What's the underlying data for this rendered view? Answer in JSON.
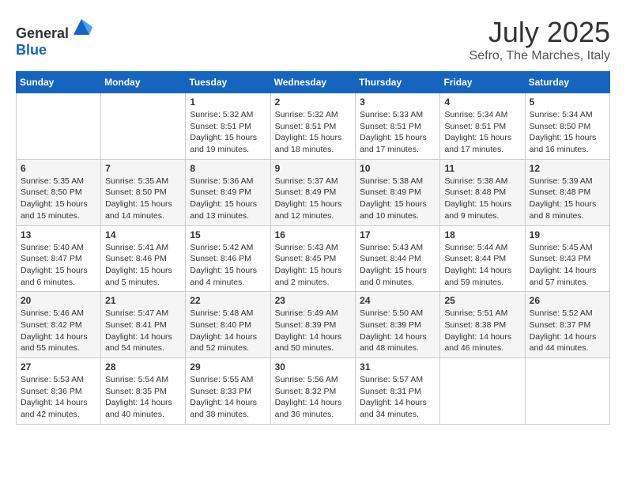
{
  "header": {
    "logo_general": "General",
    "logo_blue": "Blue",
    "month_year": "July 2025",
    "location": "Sefro, The Marches, Italy"
  },
  "weekdays": [
    "Sunday",
    "Monday",
    "Tuesday",
    "Wednesday",
    "Thursday",
    "Friday",
    "Saturday"
  ],
  "weeks": [
    [
      {
        "day": "",
        "info": ""
      },
      {
        "day": "",
        "info": ""
      },
      {
        "day": "1",
        "info": "Sunrise: 5:32 AM\nSunset: 8:51 PM\nDaylight: 15 hours and 19 minutes."
      },
      {
        "day": "2",
        "info": "Sunrise: 5:32 AM\nSunset: 8:51 PM\nDaylight: 15 hours and 18 minutes."
      },
      {
        "day": "3",
        "info": "Sunrise: 5:33 AM\nSunset: 8:51 PM\nDaylight: 15 hours and 17 minutes."
      },
      {
        "day": "4",
        "info": "Sunrise: 5:34 AM\nSunset: 8:51 PM\nDaylight: 15 hours and 17 minutes."
      },
      {
        "day": "5",
        "info": "Sunrise: 5:34 AM\nSunset: 8:50 PM\nDaylight: 15 hours and 16 minutes."
      }
    ],
    [
      {
        "day": "6",
        "info": "Sunrise: 5:35 AM\nSunset: 8:50 PM\nDaylight: 15 hours and 15 minutes."
      },
      {
        "day": "7",
        "info": "Sunrise: 5:35 AM\nSunset: 8:50 PM\nDaylight: 15 hours and 14 minutes."
      },
      {
        "day": "8",
        "info": "Sunrise: 5:36 AM\nSunset: 8:49 PM\nDaylight: 15 hours and 13 minutes."
      },
      {
        "day": "9",
        "info": "Sunrise: 5:37 AM\nSunset: 8:49 PM\nDaylight: 15 hours and 12 minutes."
      },
      {
        "day": "10",
        "info": "Sunrise: 5:38 AM\nSunset: 8:49 PM\nDaylight: 15 hours and 10 minutes."
      },
      {
        "day": "11",
        "info": "Sunrise: 5:38 AM\nSunset: 8:48 PM\nDaylight: 15 hours and 9 minutes."
      },
      {
        "day": "12",
        "info": "Sunrise: 5:39 AM\nSunset: 8:48 PM\nDaylight: 15 hours and 8 minutes."
      }
    ],
    [
      {
        "day": "13",
        "info": "Sunrise: 5:40 AM\nSunset: 8:47 PM\nDaylight: 15 hours and 6 minutes."
      },
      {
        "day": "14",
        "info": "Sunrise: 5:41 AM\nSunset: 8:46 PM\nDaylight: 15 hours and 5 minutes."
      },
      {
        "day": "15",
        "info": "Sunrise: 5:42 AM\nSunset: 8:46 PM\nDaylight: 15 hours and 4 minutes."
      },
      {
        "day": "16",
        "info": "Sunrise: 5:43 AM\nSunset: 8:45 PM\nDaylight: 15 hours and 2 minutes."
      },
      {
        "day": "17",
        "info": "Sunrise: 5:43 AM\nSunset: 8:44 PM\nDaylight: 15 hours and 0 minutes."
      },
      {
        "day": "18",
        "info": "Sunrise: 5:44 AM\nSunset: 8:44 PM\nDaylight: 14 hours and 59 minutes."
      },
      {
        "day": "19",
        "info": "Sunrise: 5:45 AM\nSunset: 8:43 PM\nDaylight: 14 hours and 57 minutes."
      }
    ],
    [
      {
        "day": "20",
        "info": "Sunrise: 5:46 AM\nSunset: 8:42 PM\nDaylight: 14 hours and 55 minutes."
      },
      {
        "day": "21",
        "info": "Sunrise: 5:47 AM\nSunset: 8:41 PM\nDaylight: 14 hours and 54 minutes."
      },
      {
        "day": "22",
        "info": "Sunrise: 5:48 AM\nSunset: 8:40 PM\nDaylight: 14 hours and 52 minutes."
      },
      {
        "day": "23",
        "info": "Sunrise: 5:49 AM\nSunset: 8:39 PM\nDaylight: 14 hours and 50 minutes."
      },
      {
        "day": "24",
        "info": "Sunrise: 5:50 AM\nSunset: 8:39 PM\nDaylight: 14 hours and 48 minutes."
      },
      {
        "day": "25",
        "info": "Sunrise: 5:51 AM\nSunset: 8:38 PM\nDaylight: 14 hours and 46 minutes."
      },
      {
        "day": "26",
        "info": "Sunrise: 5:52 AM\nSunset: 8:37 PM\nDaylight: 14 hours and 44 minutes."
      }
    ],
    [
      {
        "day": "27",
        "info": "Sunrise: 5:53 AM\nSunset: 8:36 PM\nDaylight: 14 hours and 42 minutes."
      },
      {
        "day": "28",
        "info": "Sunrise: 5:54 AM\nSunset: 8:35 PM\nDaylight: 14 hours and 40 minutes."
      },
      {
        "day": "29",
        "info": "Sunrise: 5:55 AM\nSunset: 8:33 PM\nDaylight: 14 hours and 38 minutes."
      },
      {
        "day": "30",
        "info": "Sunrise: 5:56 AM\nSunset: 8:32 PM\nDaylight: 14 hours and 36 minutes."
      },
      {
        "day": "31",
        "info": "Sunrise: 5:57 AM\nSunset: 8:31 PM\nDaylight: 14 hours and 34 minutes."
      },
      {
        "day": "",
        "info": ""
      },
      {
        "day": "",
        "info": ""
      }
    ]
  ]
}
